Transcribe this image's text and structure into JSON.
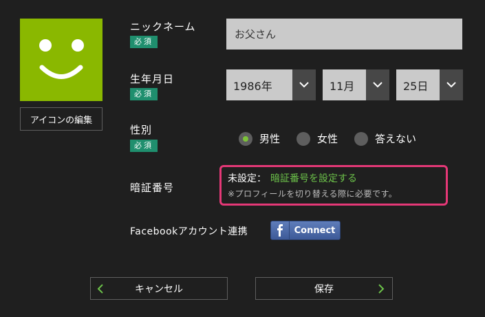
{
  "avatar": {
    "edit_label": "アイコンの編集",
    "color": "#8ab800"
  },
  "badge": {
    "required": "必須"
  },
  "nickname": {
    "label": "ニックネーム",
    "value": "お父さん"
  },
  "birthday": {
    "label": "生年月日",
    "year": "1986年",
    "month": "11月",
    "day": "25日"
  },
  "gender": {
    "label": "性別",
    "options": [
      "男性",
      "女性",
      "答えない"
    ],
    "selected": "男性"
  },
  "pin": {
    "label": "暗証番号",
    "status": "未設定：",
    "link": "暗証番号を設定する",
    "note": "※プロフィールを切り替える際に必要です。"
  },
  "facebook": {
    "label": "Facebookアカウント連携",
    "button": "Connect"
  },
  "buttons": {
    "cancel": "キャンセル",
    "save": "保存"
  },
  "colors": {
    "accent_green": "#6cc24a",
    "badge_green": "#1f8f6e",
    "highlight_pink": "#e53877"
  }
}
